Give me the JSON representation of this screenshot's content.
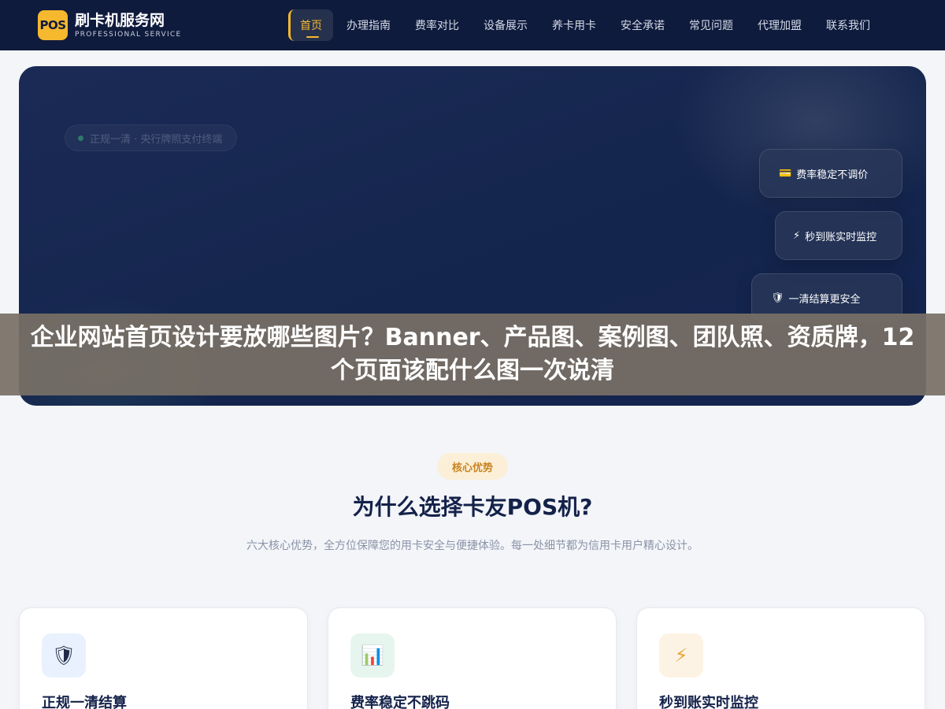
{
  "header": {
    "logo_mark": "POS",
    "logo_title": "刷卡机服务网",
    "logo_subtitle": "PROFESSIONAL SERVICE",
    "nav": [
      {
        "label": "首页",
        "active": true
      },
      {
        "label": "办理指南"
      },
      {
        "label": "费率对比"
      },
      {
        "label": "设备展示"
      },
      {
        "label": "养卡用卡"
      },
      {
        "label": "安全承诺"
      },
      {
        "label": "常见问题"
      },
      {
        "label": "代理加盟"
      },
      {
        "label": "联系我们"
      }
    ]
  },
  "hero": {
    "badge": "正规一清 · 央行牌照支付终端",
    "float_cards": [
      {
        "icon": "💳",
        "label": "费率稳定不调价"
      },
      {
        "icon": "⚡",
        "label": "秒到账实时监控"
      },
      {
        "icon": "🛡",
        "label": "一清结算更安全"
      }
    ]
  },
  "banner": {
    "title": "企业网站首页设计要放哪些图片？Banner、产品图、案例图、团队照、资质牌，12个页面该配什么图一次说清"
  },
  "advantages": {
    "tag": "核心优势",
    "title": "为什么选择卡友POS机?",
    "description": "六大核心优势，全方位保障您的用卡安全与便捷体验。每一处细节都为信用卡用户精心设计。",
    "cards": [
      {
        "icon": "🛡",
        "title": "正规一清结算"
      },
      {
        "icon": "📊",
        "title": "费率稳定不跳码"
      },
      {
        "icon": "⚡",
        "title": "秒到账实时监控"
      }
    ]
  }
}
